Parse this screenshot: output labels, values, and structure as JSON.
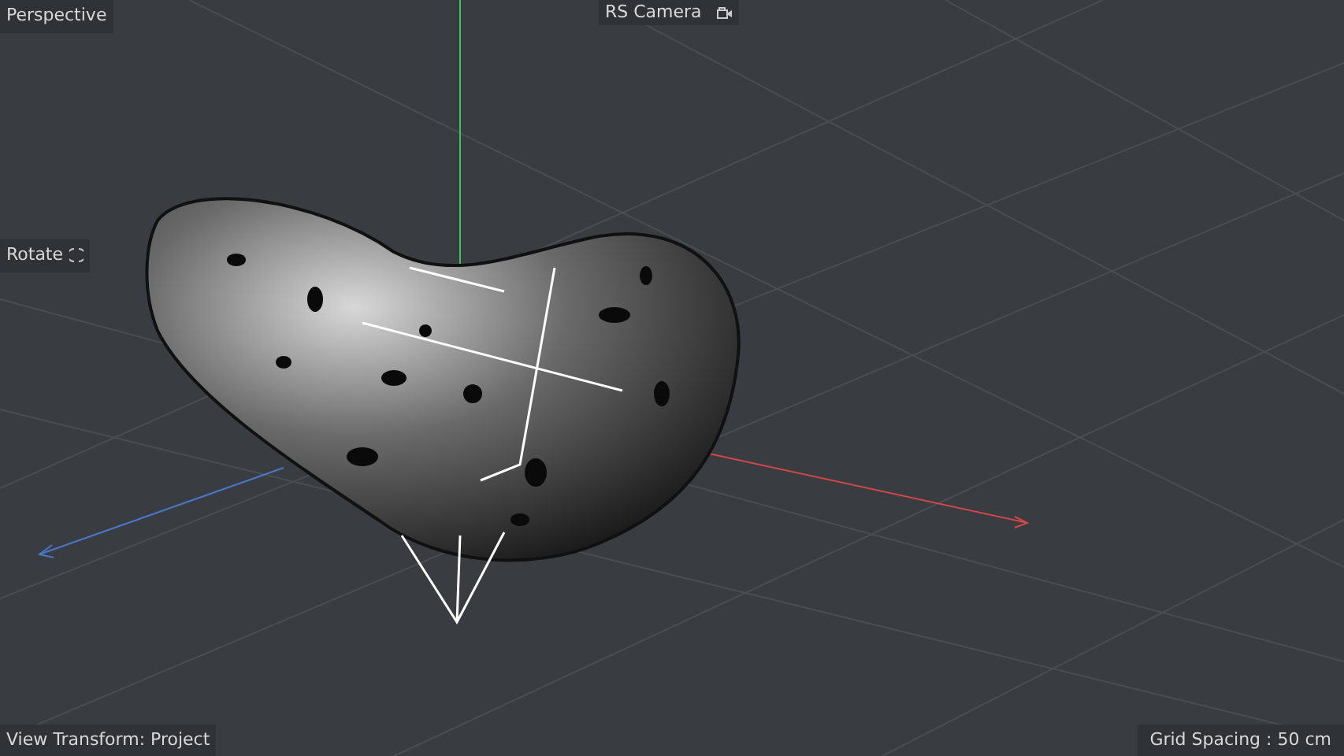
{
  "viewport": {
    "projection": "Perspective",
    "camera": "RS Camera",
    "mode": "Rotate",
    "view_transform": "View Transform: Project",
    "grid_spacing": "Grid Spacing : 50 cm"
  }
}
